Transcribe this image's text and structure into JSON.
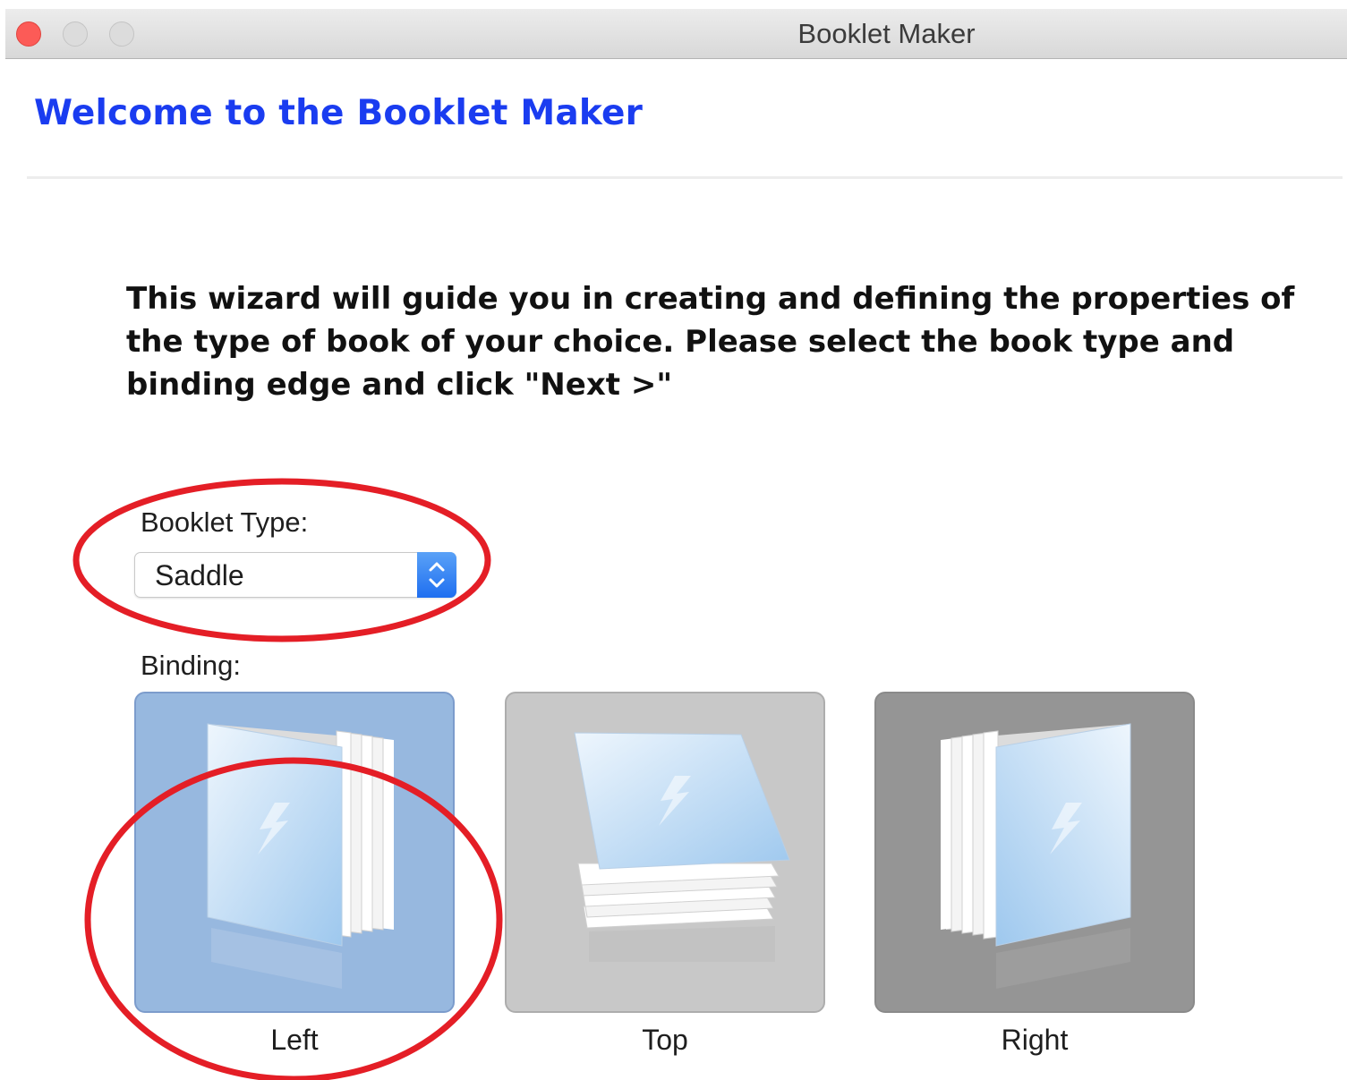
{
  "window": {
    "title": "Booklet Maker",
    "controls": [
      "close",
      "minimize",
      "zoom"
    ]
  },
  "header": {
    "welcome": "Welcome to the Booklet Maker"
  },
  "intro": {
    "text": "This wizard will guide you in creating and defining the properties of the type of book of your choice. Please select the book type and binding edge and click \"Next >\""
  },
  "booklet_type": {
    "label": "Booklet Type:",
    "value": "Saddle"
  },
  "binding": {
    "label": "Binding:",
    "selected": "Left",
    "options": [
      {
        "label": "Left",
        "state": "selected"
      },
      {
        "label": "Top",
        "state": "normal"
      },
      {
        "label": "Right",
        "state": "pressed"
      }
    ]
  },
  "colors": {
    "accent_link": "#1a3cf0",
    "selected_tile": "#97b8df",
    "annotation": "#e41e26"
  },
  "annotations": [
    "red-circle-booklet-type",
    "red-circle-left-binding"
  ]
}
